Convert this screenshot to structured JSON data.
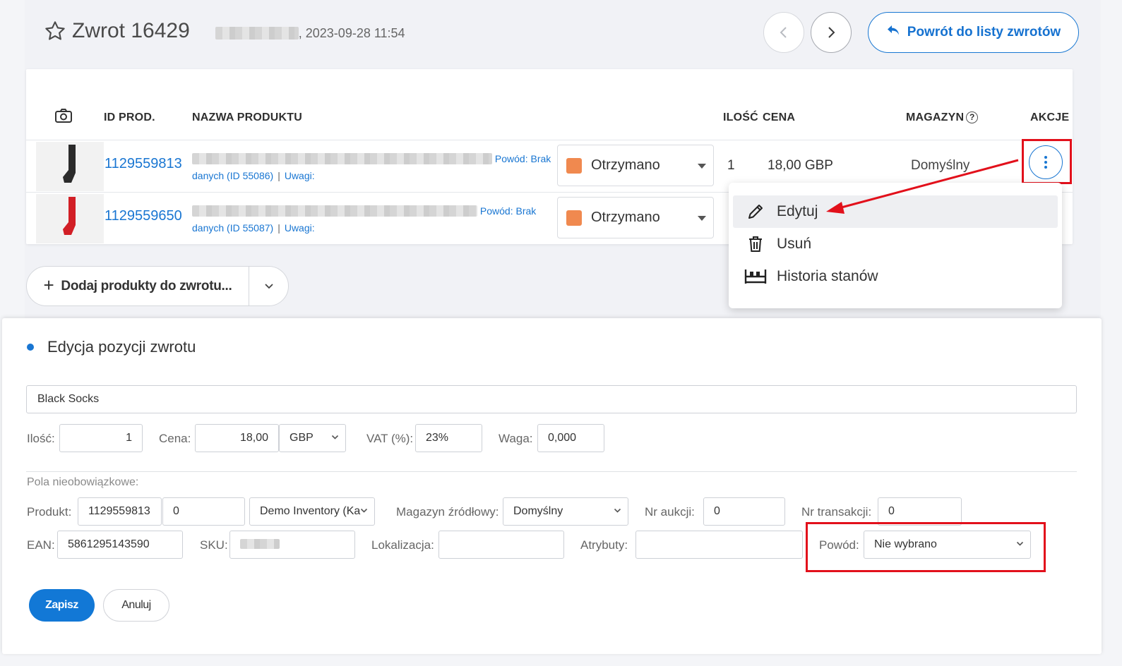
{
  "header": {
    "title": "Zwrot 16429",
    "date": ", 2023-09-28 11:54",
    "back_label": "Powrót do listy zwrotów"
  },
  "table": {
    "columns": {
      "id": "ID PROD.",
      "name": "NAZWA PRODUKTU",
      "qty": "ILOŚĆ",
      "price": "CENA",
      "warehouse": "MAGAZYN",
      "actions": "AKCJE"
    },
    "rows": [
      {
        "id": "1129559813",
        "reason_label": "Powód: Brak",
        "reason_rest": "danych (ID 55086)",
        "notes_label": "Uwagi:",
        "status": "Otrzymano",
        "qty": "1",
        "price": "18,00 GBP",
        "warehouse": "Domyślny",
        "sock_color": "#2b2b2b"
      },
      {
        "id": "1129559650",
        "reason_label": "Powód: Brak",
        "reason_rest": "danych (ID 55087)",
        "notes_label": "Uwagi:",
        "status": "Otrzymano",
        "sock_color": "#d21f26"
      }
    ]
  },
  "menu": {
    "items": [
      {
        "label": "Edytuj",
        "icon": "pencil-icon"
      },
      {
        "label": "Usuń",
        "icon": "trash-icon"
      },
      {
        "label": "Historia stanów",
        "icon": "history-icon"
      }
    ]
  },
  "add_products_label": "Dodaj produkty do zwrotu...",
  "edit": {
    "title": "Edycja pozycji zwrotu",
    "name_value": "Black Socks",
    "qty_label": "Ilość:",
    "qty_value": "1",
    "price_label": "Cena:",
    "price_value": "18,00",
    "currency": "GBP",
    "vat_label": "VAT (%):",
    "vat_value": "23%",
    "weight_label": "Waga:",
    "weight_value": "0,000",
    "optional_label": "Pola nieobowiązkowe:",
    "product_label": "Produkt:",
    "product_value": "1129559813",
    "variant_value": "0",
    "inventory_value": "Demo Inventory (Ka",
    "source_wh_label": "Magazyn źródłowy:",
    "source_wh_value": "Domyślny",
    "auction_label": "Nr aukcji:",
    "auction_value": "0",
    "transaction_label": "Nr transakcji:",
    "transaction_value": "0",
    "ean_label": "EAN:",
    "ean_value": "5861295143590",
    "sku_label": "SKU:",
    "location_label": "Lokalizacja:",
    "attributes_label": "Atrybuty:",
    "reason_label": "Powód:",
    "reason_value": "Nie wybrano",
    "save_label": "Zapisz",
    "cancel_label": "Anuluj"
  },
  "colors": {
    "accent": "#1976d2",
    "status": "#f0894f",
    "highlight": "#e2101b"
  }
}
